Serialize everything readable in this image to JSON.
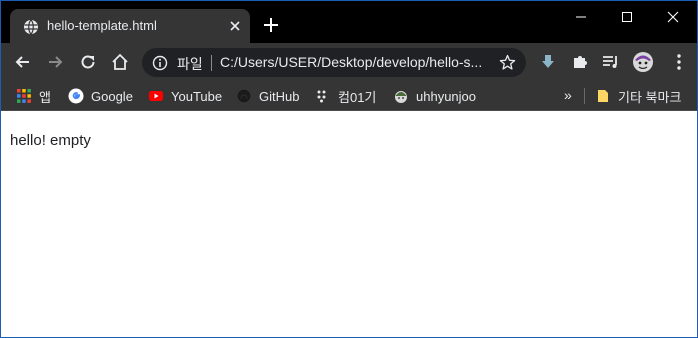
{
  "tab": {
    "title": "hello-template.html"
  },
  "omnibox": {
    "scheme_label": "파일",
    "url": "C:/Users/USER/Desktop/develop/hello-s..."
  },
  "bookmarks": {
    "items": [
      {
        "label": "앱",
        "icon": "apps-grid-icon"
      },
      {
        "label": "Google",
        "icon": "google-icon"
      },
      {
        "label": "YouTube",
        "icon": "youtube-icon"
      },
      {
        "label": "GitHub",
        "icon": "github-icon"
      },
      {
        "label": "컴01기",
        "icon": "dots-icon"
      },
      {
        "label": "uhhyunjoo",
        "icon": "avatar-icon"
      }
    ],
    "overflow": "»",
    "other_folder": "기타 북마크"
  },
  "page": {
    "body_text": "hello! empty"
  },
  "colors": {
    "tabstrip": "#000000",
    "toolbar": "#353535",
    "omnibox": "#202124",
    "text": "#e8eaed"
  }
}
